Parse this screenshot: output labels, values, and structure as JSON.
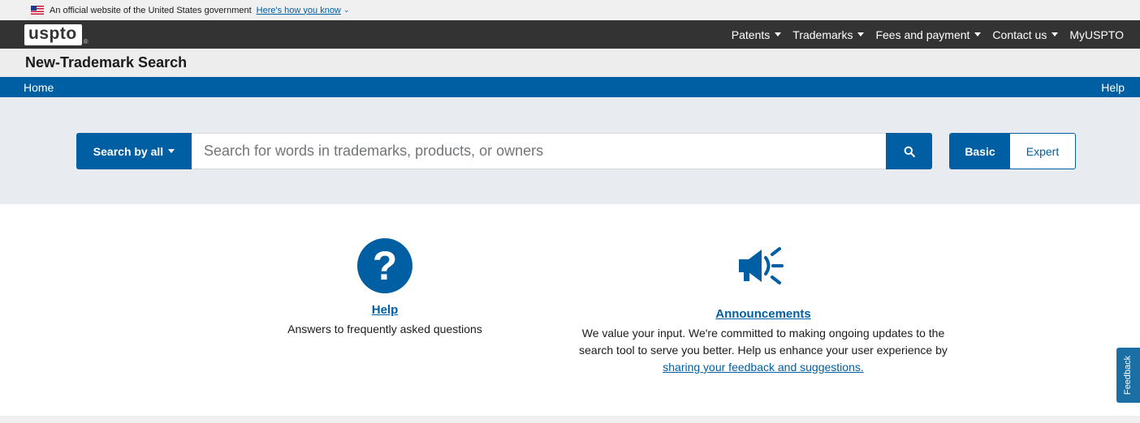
{
  "gov_banner": {
    "text": "An official website of the United States government",
    "link": "Here's how you know",
    "chevron": "⌄"
  },
  "header": {
    "logo": "uspto",
    "logo_reg": "®",
    "nav": [
      {
        "label": "Patents",
        "has_caret": true
      },
      {
        "label": "Trademarks",
        "has_caret": true
      },
      {
        "label": "Fees and payment",
        "has_caret": true
      },
      {
        "label": "Contact us",
        "has_caret": true
      },
      {
        "label": "MyUSPTO",
        "has_caret": false
      }
    ]
  },
  "title": "New-Trademark Search",
  "breadcrumb": {
    "home": "Home",
    "help": "Help"
  },
  "search": {
    "scope_label": "Search by all",
    "placeholder": "Search for words in trademarks, products, or owners",
    "value": "",
    "button_icon": "search-icon",
    "mode_basic": "Basic",
    "mode_expert": "Expert",
    "active_mode": "Basic"
  },
  "cards": {
    "help": {
      "icon": "question-circle-icon",
      "icon_glyph": "?",
      "title": "Help",
      "desc": "Answers to frequently asked questions"
    },
    "announcements": {
      "icon": "megaphone-icon",
      "title": "Announcements",
      "desc_part1": "We value your input. We're committed to making ongoing updates to the search tool to serve you better. Help us enhance your user experience by",
      "desc_link": "sharing your feedback and suggestions."
    }
  },
  "feedback": "Feedback",
  "colors": {
    "primary": "#005ea2",
    "header_bg": "#333333",
    "search_bg": "#e8ebef"
  }
}
